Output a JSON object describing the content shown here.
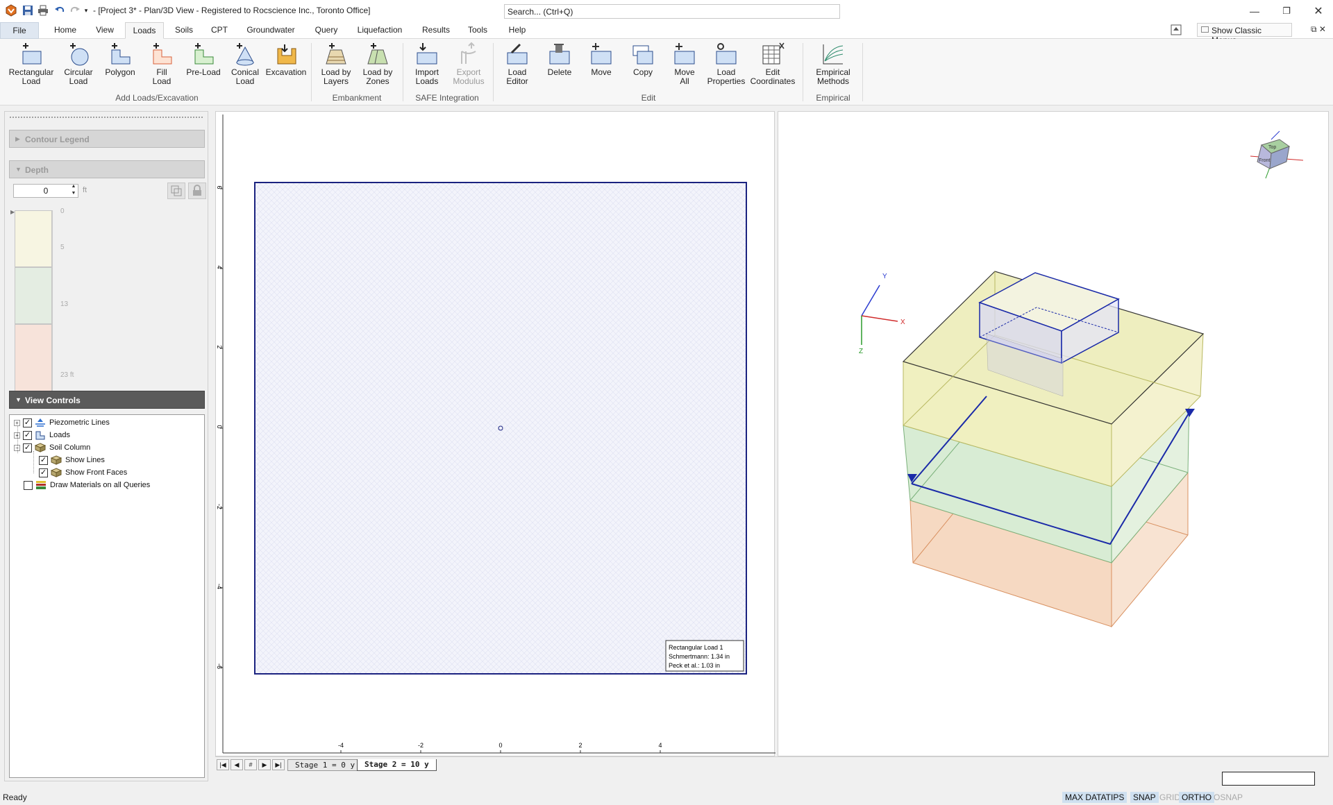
{
  "window": {
    "title": "- [Project 3* - Plan/3D View - Registered to Rocscience Inc., Toronto Office]",
    "search_placeholder": "Search... (Ctrl+Q)"
  },
  "menu": {
    "tabs": [
      "File",
      "Home",
      "View",
      "Loads",
      "Soils",
      "CPT",
      "Groundwater",
      "Query",
      "Liquefaction",
      "Results",
      "Tools",
      "Help"
    ],
    "active": "Loads",
    "show_classic_menus": "Show Classic Menus"
  },
  "ribbon": {
    "buttons": [
      {
        "label": "Rectangular\nLoad",
        "icon": "rectangular-load-icon"
      },
      {
        "label": "Circular\nLoad",
        "icon": "circular-load-icon"
      },
      {
        "label": "Polygon",
        "icon": "polygon-load-icon"
      },
      {
        "label": "Fill\nLoad",
        "icon": "fill-load-icon"
      },
      {
        "label": "Pre-Load",
        "icon": "pre-load-icon"
      },
      {
        "label": "Conical\nLoad",
        "icon": "conical-load-icon"
      },
      {
        "label": "Excavation",
        "icon": "excavation-icon"
      },
      {
        "label": "Load by\nLayers",
        "icon": "load-by-layers-icon"
      },
      {
        "label": "Load by\nZones",
        "icon": "load-by-zones-icon"
      },
      {
        "label": "Import\nLoads",
        "icon": "import-loads-icon"
      },
      {
        "label": "Export\nModulus",
        "icon": "export-modulus-icon"
      },
      {
        "label": "Load\nEditor",
        "icon": "load-editor-icon"
      },
      {
        "label": "Delete",
        "icon": "delete-icon"
      },
      {
        "label": "Move",
        "icon": "move-icon"
      },
      {
        "label": "Copy",
        "icon": "copy-icon"
      },
      {
        "label": "Move\nAll",
        "icon": "move-all-icon"
      },
      {
        "label": "Load\nProperties",
        "icon": "load-properties-icon"
      },
      {
        "label": "Edit\nCoordinates",
        "icon": "edit-coordinates-icon"
      },
      {
        "label": "Empirical\nMethods",
        "icon": "empirical-methods-icon"
      }
    ],
    "groups": [
      "Add Loads/Excavation",
      "Embankment",
      "SAFE Integration",
      "Edit",
      "Empirical"
    ]
  },
  "left_panel": {
    "contour_legend": "Contour Legend",
    "depth": {
      "title": "Depth",
      "value": "0",
      "unit": "ft",
      "ticks": [
        "0",
        "5",
        "13",
        "23 ft"
      ],
      "layer_colors": [
        "#f7f5e2",
        "#e4ede2",
        "#f7e3da"
      ]
    },
    "view_controls": {
      "title": "View Controls",
      "items": [
        {
          "label": "Piezometric Lines",
          "checked": true
        },
        {
          "label": "Loads",
          "checked": true
        },
        {
          "label": "Soil Column",
          "checked": true
        },
        {
          "label": "Show Lines",
          "checked": true
        },
        {
          "label": "Show Front Faces",
          "checked": true
        },
        {
          "label": "Draw Materials on all Queries",
          "checked": false
        }
      ]
    }
  },
  "plan_view": {
    "y_ticks": [
      "6",
      "4",
      "2",
      "0",
      "-2",
      "-4",
      "-6"
    ],
    "x_ticks": [
      "-4",
      "-2",
      "0",
      "2",
      "4"
    ],
    "info_box": [
      "Rectangular Load 1",
      "Schmertmann: 1.34 in",
      "Peck et al.: 1.03 in"
    ]
  },
  "view_3d": {
    "axes": {
      "x": "X",
      "y": "Y",
      "z": "Z"
    },
    "cube": {
      "top": "Top",
      "front": "Front"
    },
    "colors": {
      "layer1": "#f0f0c0",
      "layer2": "#d8ecd4",
      "layer3": "#f6d9c2",
      "load": "#d8d8f4",
      "edge_blue": "#1a2aa8"
    }
  },
  "stages": {
    "tabs": [
      "Stage 1 = 0 y",
      "Stage 2 = 10 y"
    ],
    "active": "Stage 2 = 10 y"
  },
  "status": {
    "text": "Ready",
    "toggles": [
      {
        "label": "MAX DATATIPS",
        "on": true
      },
      {
        "label": "SNAP",
        "on": true
      },
      {
        "label": "GRID",
        "on": false
      },
      {
        "label": "ORTHO",
        "on": true
      },
      {
        "label": "OSNAP",
        "on": false
      }
    ]
  }
}
